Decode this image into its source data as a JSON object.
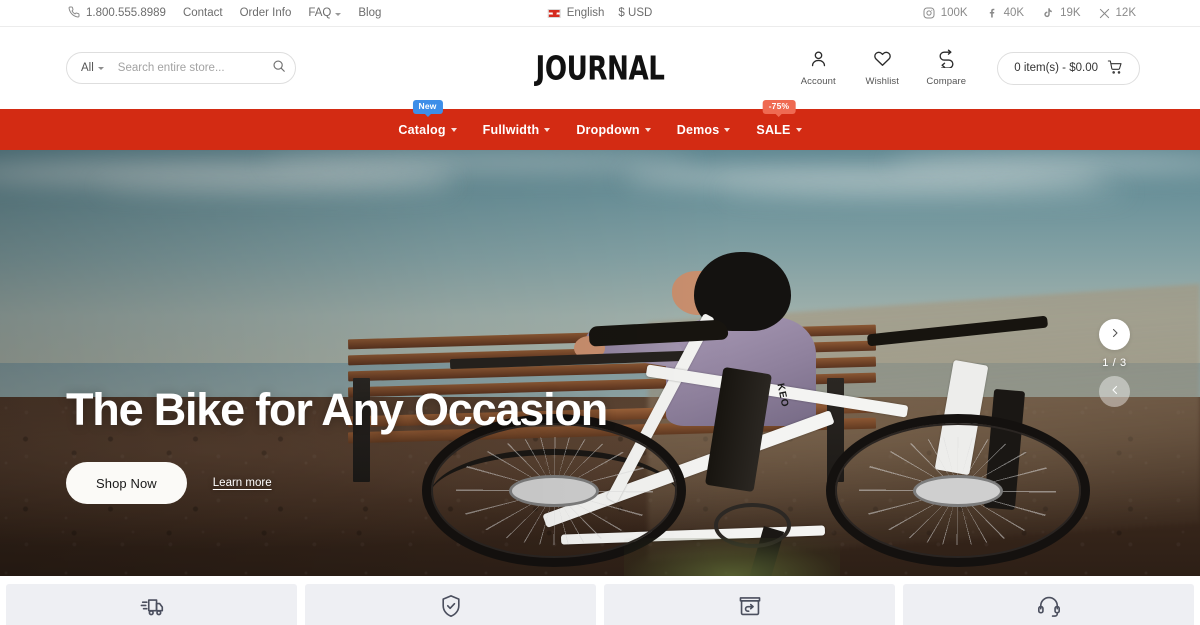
{
  "topbar": {
    "phone": "1.800.555.8989",
    "phone_icon": "phone-icon",
    "links": [
      {
        "label": "Contact",
        "caret": false
      },
      {
        "label": "Order Info",
        "caret": false
      },
      {
        "label": "FAQ",
        "caret": true
      },
      {
        "label": "Blog",
        "caret": false
      }
    ],
    "language": "English",
    "currency": "$ USD",
    "socials": [
      {
        "icon": "instagram-icon",
        "count": "100K"
      },
      {
        "icon": "facebook-icon",
        "count": "40K"
      },
      {
        "icon": "tiktok-icon",
        "count": "19K"
      },
      {
        "icon": "x-twitter-icon",
        "count": "12K"
      }
    ]
  },
  "header": {
    "search": {
      "category": "All",
      "placeholder": "Search entire store...",
      "value": "",
      "icon": "search-icon"
    },
    "logo": "JOURNAL",
    "actions": [
      {
        "icon": "user-icon",
        "label": "Account"
      },
      {
        "icon": "heart-icon",
        "label": "Wishlist"
      },
      {
        "icon": "compare-icon",
        "label": "Compare"
      }
    ],
    "cart": {
      "label": "0 item(s) - $0.00",
      "icon": "cart-icon"
    }
  },
  "nav": {
    "background": "#d32b13",
    "items": [
      {
        "label": "Catalog",
        "caret": true,
        "badge": "New",
        "badge_type": "new"
      },
      {
        "label": "Fullwidth",
        "caret": true,
        "badge": null,
        "badge_type": null
      },
      {
        "label": "Dropdown",
        "caret": true,
        "badge": null,
        "badge_type": null
      },
      {
        "label": "Demos",
        "caret": true,
        "badge": null,
        "badge_type": null
      },
      {
        "label": "SALE",
        "caret": true,
        "badge": "-75%",
        "badge_type": "sale"
      }
    ]
  },
  "hero": {
    "title": "The Bike for Any Occasion",
    "primary_button": "Shop Now",
    "secondary_link": "Learn more",
    "slide_counter": "1 / 3",
    "next_icon": "chevron-right-icon",
    "prev_icon": "chevron-left-icon",
    "bike_brand": "KEO"
  },
  "features": [
    {
      "icon": "delivery-truck-icon",
      "name": "free-shipping"
    },
    {
      "icon": "shield-check-icon",
      "name": "secure-payment"
    },
    {
      "icon": "return-box-icon",
      "name": "easy-returns"
    },
    {
      "icon": "headset-icon",
      "name": "support"
    }
  ]
}
